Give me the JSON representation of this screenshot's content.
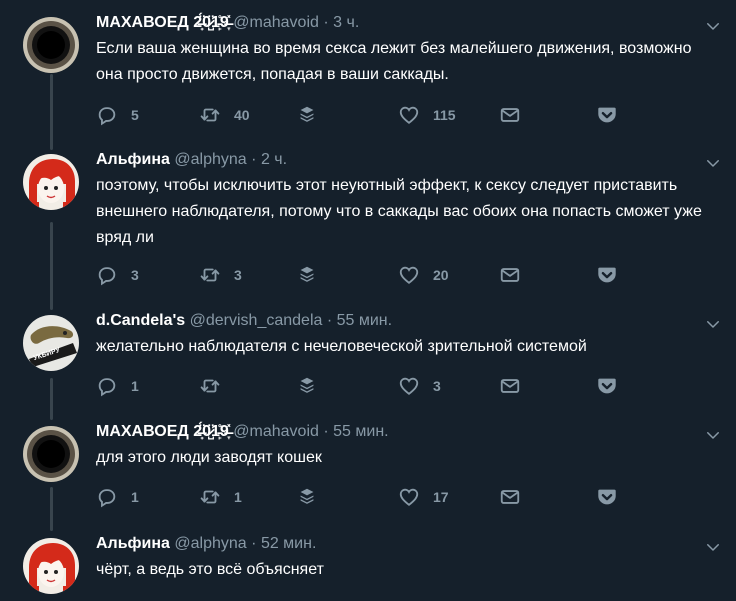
{
  "colors": {
    "background": "#15202b",
    "muted": "#8899a6",
    "thread_line": "#38444d",
    "text": "#ffffff"
  },
  "tweets": [
    {
      "name": "МАХАВОЕД 2̶̟̈́0̷̺̈1̵̙̊9̶̞̽",
      "handle": "@mahavoid",
      "dot": "·",
      "time": "3 ч.",
      "text": "Если ваша женщина во время секса лежит без малейшего движения, возможно она просто движется, попадая в ваши саккады.",
      "replies": "5",
      "retweets": "40",
      "likes": "115",
      "avatar": "black-hole"
    },
    {
      "name": "Альфина",
      "handle": "@alphyna",
      "dot": "·",
      "time": "2 ч.",
      "text": "поэтому, чтобы исключить этот неуютный эффект, к сексу следует приставить внешнего наблюдателя, потому что в саккады вас обоих она попасть сможет уже вряд ли",
      "replies": "3",
      "retweets": "3",
      "likes": "20",
      "avatar": "red-hair-girl"
    },
    {
      "name": "d.Candela's",
      "handle": "@dervish_candela",
      "dot": "·",
      "time": "55 мин.",
      "text": "желательно наблюдателя с нечеловеческой зрительной системой",
      "replies": "1",
      "retweets": "",
      "likes": "3",
      "avatar": "lizard",
      "avatar_caption": "УКБИРУ"
    },
    {
      "name": "МАХАВОЕД 2̶̟̈́0̷̺̈1̵̙̊9̶̞̽",
      "handle": "@mahavoid",
      "dot": "·",
      "time": "55 мин.",
      "text": "для этого люди заводят кошек",
      "replies": "1",
      "retweets": "1",
      "likes": "17",
      "avatar": "black-hole"
    },
    {
      "name": "Альфина",
      "handle": "@alphyna",
      "dot": "·",
      "time": "52 мин.",
      "text": "чёрт, а ведь это всё объясняет",
      "replies": "",
      "retweets": "",
      "likes": "",
      "avatar": "red-hair-girl"
    }
  ]
}
